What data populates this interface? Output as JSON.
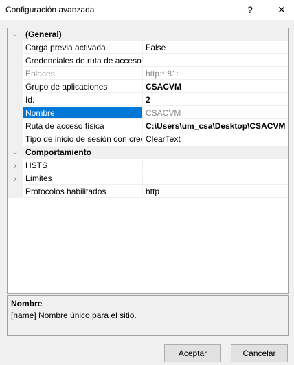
{
  "window": {
    "title": "Configuración avanzada",
    "help_label": "?",
    "close_label": "✕"
  },
  "categories": [
    {
      "label": "(General)",
      "expander": "⌄"
    },
    {
      "label": "Comportamiento",
      "expander": "⌄"
    }
  ],
  "general": [
    {
      "name": "Carga previa activada",
      "value": "False"
    },
    {
      "name": "Credenciales de ruta de acceso f",
      "value": ""
    },
    {
      "name": "Enlaces",
      "value": "http:*:81:"
    },
    {
      "name": "Grupo de aplicaciones",
      "value": "CSACVM"
    },
    {
      "name": "Id.",
      "value": "2"
    },
    {
      "name": "Nombre",
      "value": "CSACVM"
    },
    {
      "name": "Ruta de acceso física",
      "value": "C:\\Users\\um_csa\\Desktop\\CSACVM"
    },
    {
      "name": "Tipo de inicio de sesión con crec",
      "value": "ClearText"
    }
  ],
  "behavior": [
    {
      "name": "HSTS",
      "value": "",
      "expander": "›"
    },
    {
      "name": "Límites",
      "value": "",
      "expander": "›"
    },
    {
      "name": "Protocolos habilitados",
      "value": "http"
    }
  ],
  "description": {
    "title": "Nombre",
    "text": "[name] Nombre único para el sitio."
  },
  "buttons": {
    "ok": "Aceptar",
    "cancel": "Cancelar"
  },
  "colors": {
    "selection": "#0078d7"
  }
}
